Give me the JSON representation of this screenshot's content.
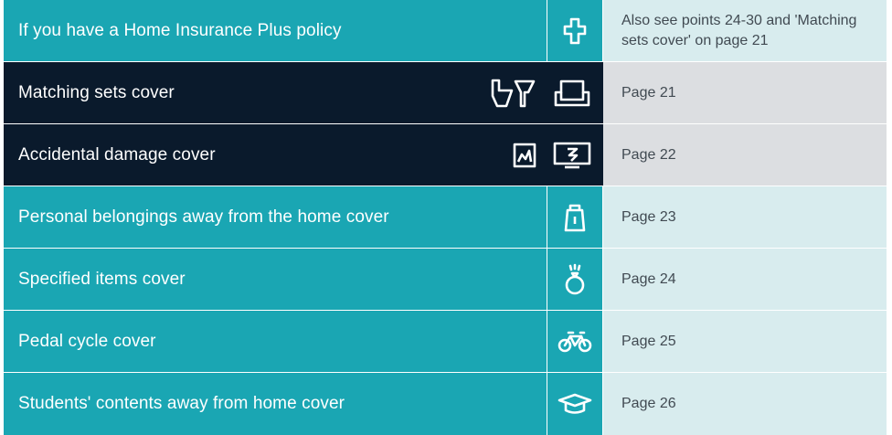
{
  "rows": [
    {
      "label": "If you have a Home Insurance Plus policy",
      "ref": "Also see points 24-30 and 'Matching sets cover' on page 21",
      "icons": [
        "plus-icon"
      ]
    },
    {
      "label": "Matching sets cover",
      "ref": "Page 21",
      "icons": [
        "bathroom-suite-icon",
        "armchair-icon"
      ]
    },
    {
      "label": "Accidental damage cover",
      "ref": "Page 22",
      "icons": [
        "broken-picture-icon",
        "broken-tv-icon"
      ]
    },
    {
      "label": "Personal belongings away from the home cover",
      "ref": "Page 23",
      "icons": [
        "handbag-icon"
      ]
    },
    {
      "label": "Specified items cover",
      "ref": "Page 24",
      "icons": [
        "ring-icon"
      ]
    },
    {
      "label": "Pedal cycle cover",
      "ref": "Page 25",
      "icons": [
        "bicycle-icon"
      ]
    },
    {
      "label": "Students' contents away from home cover",
      "ref": "Page 26",
      "icons": [
        "graduation-cap-icon"
      ]
    }
  ],
  "colors": {
    "teal": "#1aa6b3",
    "navy": "#0a1a2c",
    "ref_light": "#d8ecee",
    "ref_grey": "#dcdee1",
    "ref_text": "#414a52"
  }
}
